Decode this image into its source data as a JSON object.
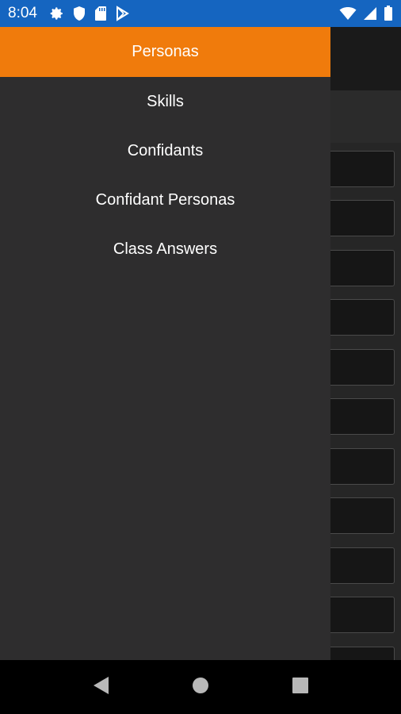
{
  "status_bar": {
    "time": "8:04",
    "left_icons": [
      "settings-icon",
      "shield-icon",
      "sd-card-icon",
      "play-store-icon"
    ],
    "right_icons": [
      "wifi-icon",
      "signal-icon",
      "battery-icon"
    ],
    "background_color": "#1565c0"
  },
  "drawer": {
    "items": [
      {
        "label": "Personas",
        "active": true
      },
      {
        "label": "Skills",
        "active": false
      },
      {
        "label": "Confidants",
        "active": false
      },
      {
        "label": "Confidant Personas",
        "active": false
      },
      {
        "label": "Class Answers",
        "active": false
      }
    ],
    "accent_color": "#f07b0c",
    "background_color": "#2e2d2e"
  },
  "nav_bar": {
    "buttons": [
      "back-icon",
      "home-icon",
      "recents-icon"
    ]
  }
}
